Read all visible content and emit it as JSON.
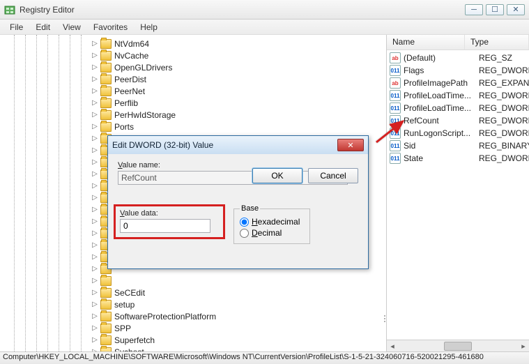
{
  "window": {
    "title": "Registry Editor"
  },
  "menu": [
    "File",
    "Edit",
    "View",
    "Favorites",
    "Help"
  ],
  "tree": [
    "NtVdm64",
    "NvCache",
    "OpenGLDrivers",
    "PeerDist",
    "PeerNet",
    "Perflib",
    "PerHwIdStorage",
    "Ports",
    "",
    "",
    "",
    "",
    "",
    "",
    "",
    "",
    "",
    "",
    "",
    "",
    "",
    "SeCEdit",
    "setup",
    "SoftwareProtectionPlatform",
    "SPP",
    "Superfetch",
    "Svchost"
  ],
  "list": {
    "headers": {
      "name": "Name",
      "type": "Type"
    },
    "rows": [
      {
        "icon": "str",
        "name": "(Default)",
        "type": "REG_SZ"
      },
      {
        "icon": "bin",
        "name": "Flags",
        "type": "REG_DWORD"
      },
      {
        "icon": "str",
        "name": "ProfileImagePath",
        "type": "REG_EXPAND_SZ"
      },
      {
        "icon": "bin",
        "name": "ProfileLoadTime...",
        "type": "REG_DWORD"
      },
      {
        "icon": "bin",
        "name": "ProfileLoadTime...",
        "type": "REG_DWORD"
      },
      {
        "icon": "bin",
        "name": "RefCount",
        "type": "REG_DWORD"
      },
      {
        "icon": "bin",
        "name": "RunLogonScript...",
        "type": "REG_DWORD"
      },
      {
        "icon": "bin",
        "name": "Sid",
        "type": "REG_BINARY"
      },
      {
        "icon": "bin",
        "name": "State",
        "type": "REG_DWORD"
      }
    ]
  },
  "dialog": {
    "title": "Edit DWORD (32-bit) Value",
    "value_name_label": "Value name:",
    "value_name": "RefCount",
    "value_data_label": "Value data:",
    "value_data": "0",
    "base_label": "Base",
    "hex_label": "Hexadecimal",
    "dec_label": "Decimal",
    "ok": "OK",
    "cancel": "Cancel"
  },
  "status": "Computer\\HKEY_LOCAL_MACHINE\\SOFTWARE\\Microsoft\\Windows NT\\CurrentVersion\\ProfileList\\S-1-5-21-324060716-520021295-461680"
}
